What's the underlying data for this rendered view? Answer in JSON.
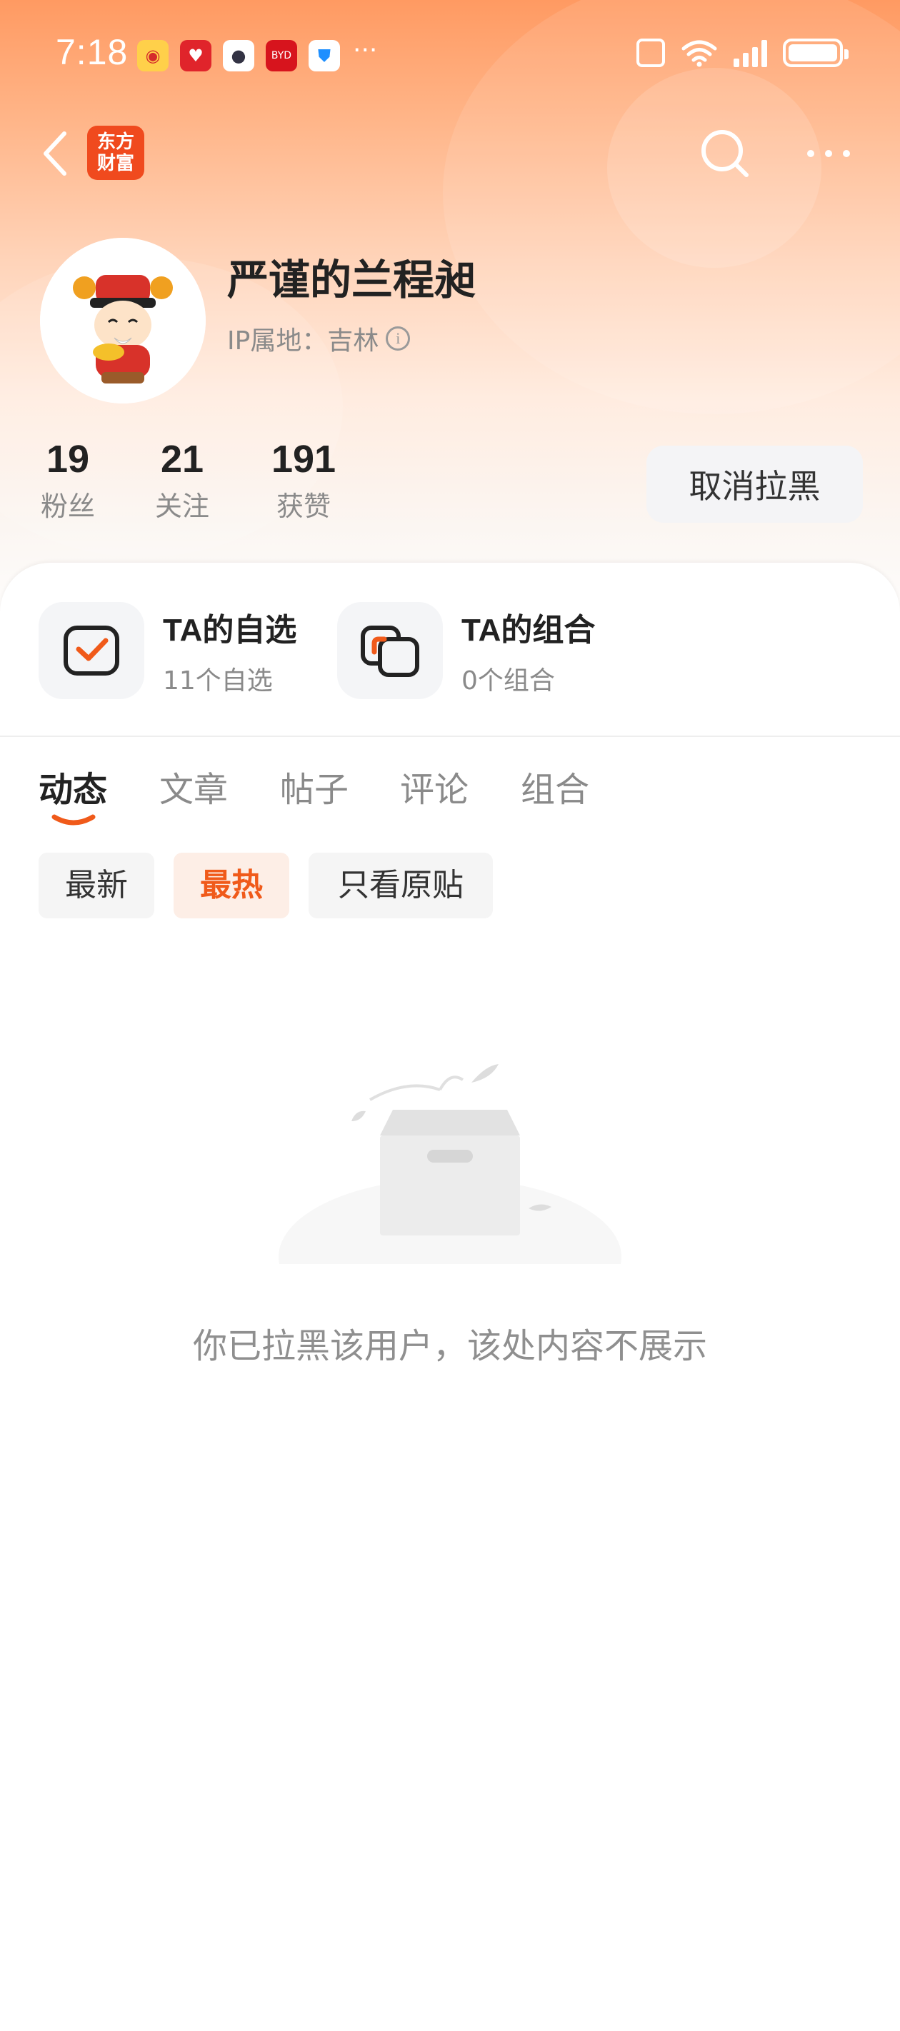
{
  "status_bar": {
    "time": "7:18",
    "app_icons": [
      "weibo-icon",
      "heart-app-icon",
      "camera-app-icon",
      "byd-app-icon",
      "shield-app-icon"
    ],
    "more": "···"
  },
  "header": {
    "logo_text_line1": "东方",
    "logo_text_line2": "财富"
  },
  "profile": {
    "username": "严谨的兰程昶",
    "ip_location": "IP属地：吉林",
    "stats": [
      {
        "value": "19",
        "label": "粉丝"
      },
      {
        "value": "21",
        "label": "关注"
      },
      {
        "value": "191",
        "label": "获赞"
      }
    ],
    "unblock_label": "取消拉黑"
  },
  "quick_links": [
    {
      "title": "TA的自选",
      "subtitle": "11个自选"
    },
    {
      "title": "TA的组合",
      "subtitle": "0个组合"
    }
  ],
  "tabs": [
    "动态",
    "文章",
    "帖子",
    "评论",
    "组合"
  ],
  "active_tab": "动态",
  "filters": [
    "最新",
    "最热",
    "只看原贴"
  ],
  "active_filter": "最热",
  "empty_state": {
    "message": "你已拉黑该用户，该处内容不展示"
  },
  "colors": {
    "accent": "#f05a1a",
    "header_top": "#ff9a62",
    "logo": "#f04a1e"
  }
}
